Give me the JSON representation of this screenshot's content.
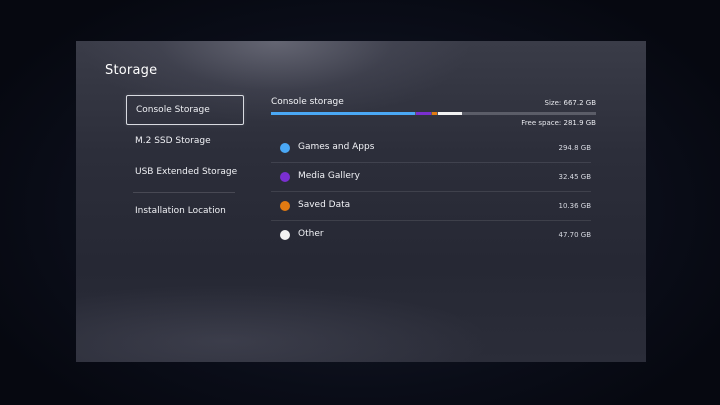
{
  "page": {
    "title": "Storage"
  },
  "sidebar": {
    "items": [
      {
        "label": "Console Storage",
        "selected": true
      },
      {
        "label": "M.2 SSD Storage",
        "selected": false
      },
      {
        "label": "USB Extended Storage",
        "selected": false
      },
      {
        "label": "Installation Location",
        "selected": false
      }
    ]
  },
  "storage": {
    "label": "Console storage",
    "size_text": "Size: 667.2 GB",
    "free_text": "Free space: 281.9 GB",
    "total_gb": 667.2,
    "free_gb": 281.9
  },
  "categories": [
    {
      "name": "Games and Apps",
      "value": "294.8 GB",
      "gb": 294.8,
      "color": "#4aa8f5"
    },
    {
      "name": "Media Gallery",
      "value": "32.45 GB",
      "gb": 32.45,
      "color": "#7a2fd0"
    },
    {
      "name": "Saved Data",
      "value": "10.36 GB",
      "gb": 10.36,
      "color": "#e07a12"
    },
    {
      "name": "Other",
      "value": "47.70 GB",
      "gb": 47.7,
      "color": "#f2f2f2"
    }
  ]
}
